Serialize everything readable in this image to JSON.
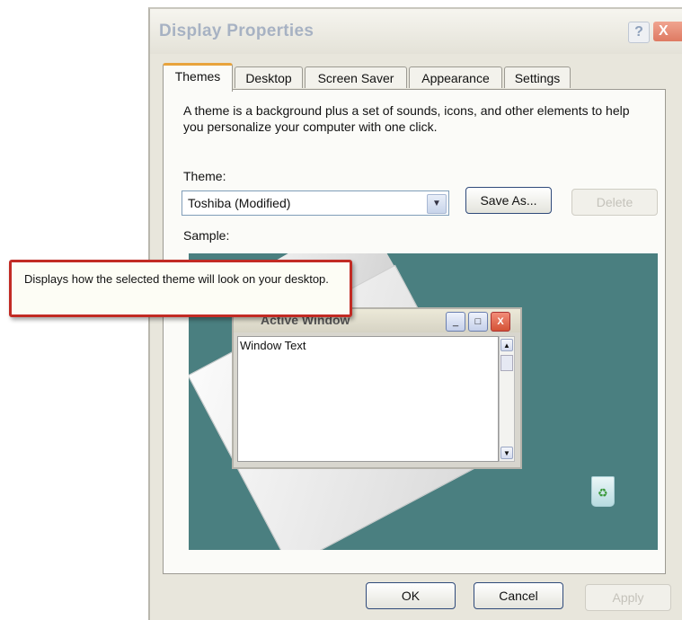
{
  "window": {
    "title": "Display Properties",
    "help_label": "?",
    "close_label": "X"
  },
  "tabs": [
    {
      "label": "Themes",
      "active": true
    },
    {
      "label": "Desktop",
      "active": false
    },
    {
      "label": "Screen Saver",
      "active": false
    },
    {
      "label": "Appearance",
      "active": false
    },
    {
      "label": "Settings",
      "active": false
    }
  ],
  "themes_panel": {
    "description": "A theme is a background plus a set of sounds, icons, and other elements to help you personalize your computer with one click.",
    "theme_label": "Theme:",
    "theme_selected": "Toshiba (Modified)",
    "save_as_label": "Save As...",
    "delete_label": "Delete",
    "sample_label": "Sample:"
  },
  "sample_preview": {
    "window_text": "Window Text",
    "active_window_title": "Active Window"
  },
  "tooltip": {
    "text": "Displays how the selected theme will look on your desktop."
  },
  "footer": {
    "ok_label": "OK",
    "cancel_label": "Cancel",
    "apply_label": "Apply"
  },
  "colors": {
    "preview_background": "#4a7f80",
    "tooltip_border": "#c22b24",
    "active_tab_accent": "#e8a33c"
  },
  "icons": {
    "select_arrow": "chevron-down-icon",
    "recycle_bin": "recycle-bin-icon"
  }
}
